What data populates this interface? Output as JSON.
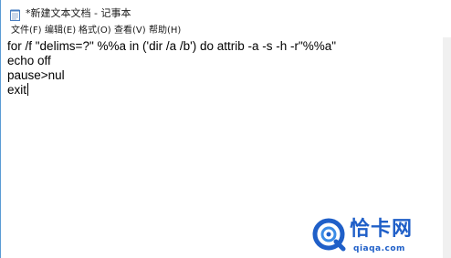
{
  "window": {
    "title": "*新建文本文档 - 记事本"
  },
  "menu": {
    "items": [
      {
        "label": "文件(F)"
      },
      {
        "label": "编辑(E)"
      },
      {
        "label": "格式(O)"
      },
      {
        "label": "查看(V)"
      },
      {
        "label": "帮助(H)"
      }
    ]
  },
  "editor": {
    "lines": [
      "for /f \"delims=?\" %%a in ('dir /a /b') do attrib -a -s -h -r\"%%a\"",
      "echo off",
      "pause>nul",
      "exit"
    ]
  },
  "watermark": {
    "title": "恰卡网",
    "subtitle": "qiaqa.com",
    "color": "#1f5fc8"
  },
  "icons": {
    "app": "notepad-icon",
    "logo": "qiaqa-logo-icon"
  }
}
